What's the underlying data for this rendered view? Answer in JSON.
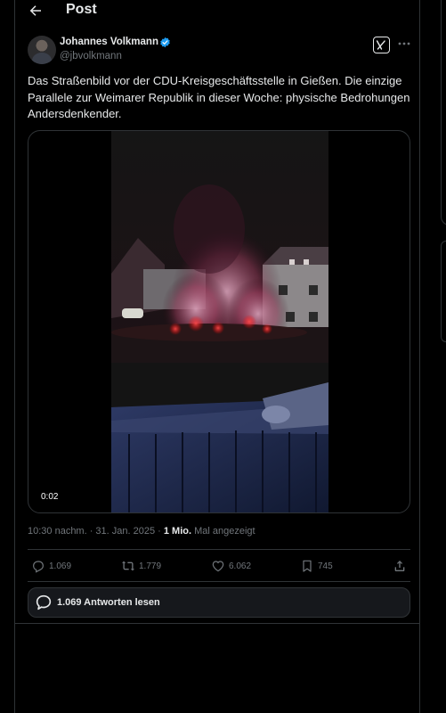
{
  "header": {
    "title": "Post"
  },
  "author": {
    "name": "Johannes Volkmann",
    "handle": "@jbvolkmann"
  },
  "tweet": {
    "text": "Das Straßenbild vor der CDU-Kreisgeschäftsstelle in Gießen. Die einzige Parallele zur Weimarer Republik in dieser Woche: physische Bedrohungen Andersdenkender."
  },
  "media": {
    "video_time": "0:02"
  },
  "meta": {
    "timestamp": "10:30 nachm. · 31. Jan. 2025 · ",
    "views_count": "1 Mio.",
    "views_label": " Mal angezeigt"
  },
  "actions": {
    "replies": "1.069",
    "reposts": "1.779",
    "likes": "6.062",
    "bookmarks": "745"
  },
  "read_replies": {
    "label": "1.069 Antworten lesen"
  },
  "icons": {
    "back": "arrow-left-icon",
    "verified": "verified-badge-icon",
    "grok": "grok-icon",
    "more": "more-horizontal-icon",
    "reply": "reply-icon",
    "repost": "repost-icon",
    "like": "heart-icon",
    "bookmark": "bookmark-icon",
    "share": "share-icon",
    "read_replies": "speech-bubble-icon"
  },
  "colors": {
    "background": "#000000",
    "text": "#e7e9ea",
    "secondary": "#71767b",
    "border": "#2f3336",
    "verified": "#1d9bf0",
    "flare": "#e0303a"
  }
}
